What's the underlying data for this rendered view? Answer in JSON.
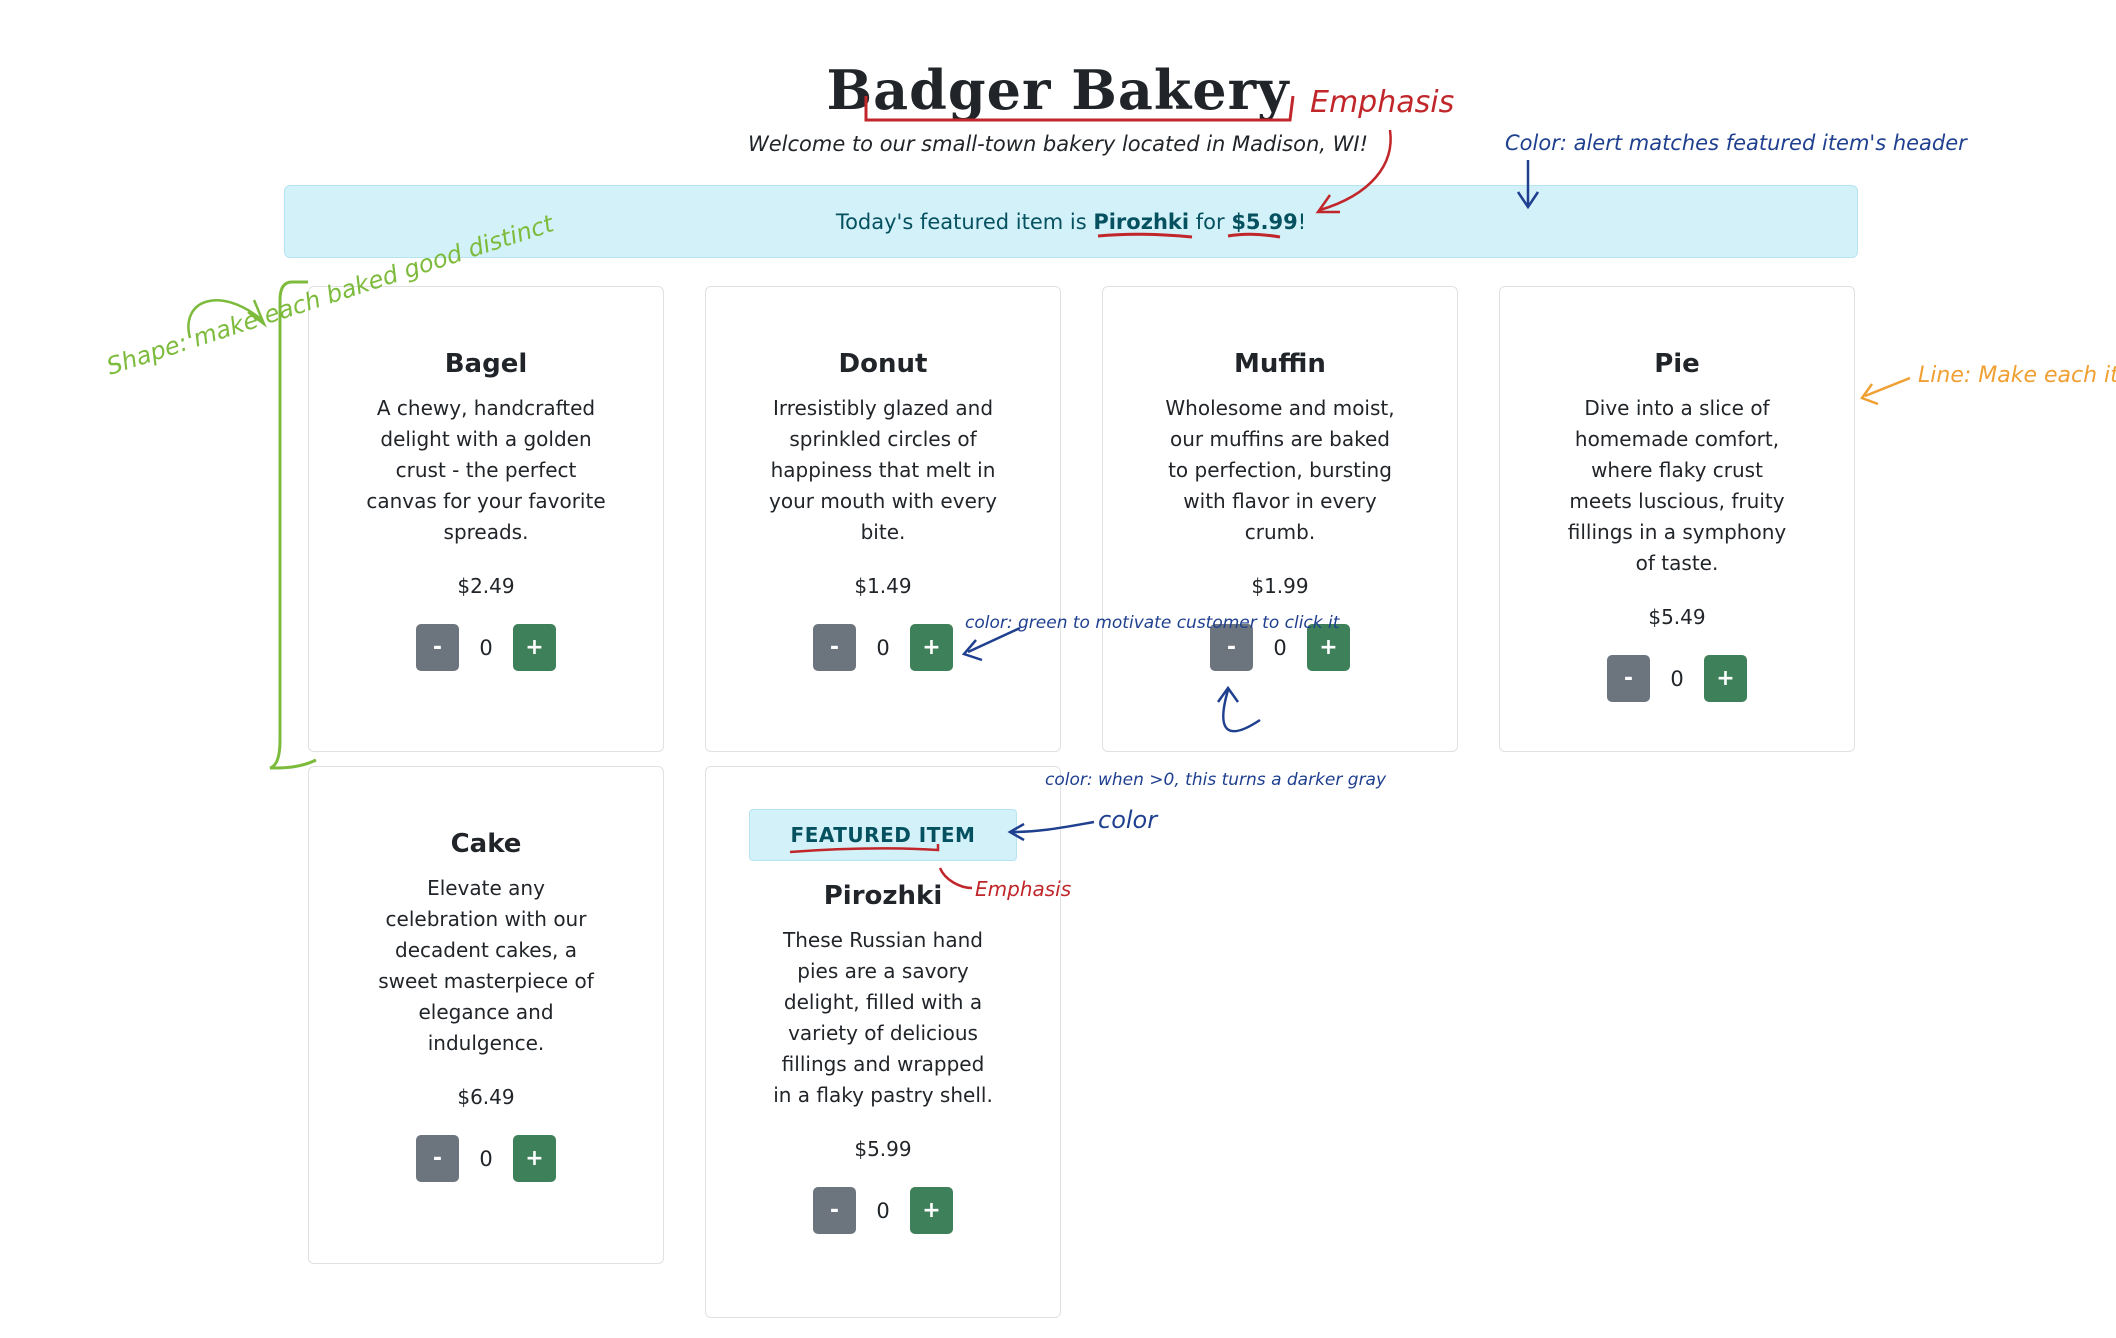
{
  "header": {
    "title": "Badger Bakery",
    "subtitle": "Welcome to our small-town bakery located in Madison, WI!"
  },
  "alert": {
    "prefix": "Today's featured item is ",
    "item": "Pirozhki",
    "middle": " for ",
    "price": "$5.99",
    "suffix": "!"
  },
  "products": [
    {
      "name": "Bagel",
      "description": "A chewy, handcrafted delight with a golden crust - the perfect canvas for your favorite spreads.",
      "price": "$2.49",
      "quantity": "0"
    },
    {
      "name": "Donut",
      "description": "Irresistibly glazed and sprinkled circles of happiness that melt in your mouth with every bite.",
      "price": "$1.49",
      "quantity": "0"
    },
    {
      "name": "Muffin",
      "description": "Wholesome and moist, our muffins are baked to perfection, bursting with flavor in every crumb.",
      "price": "$1.99",
      "quantity": "0"
    },
    {
      "name": "Pie",
      "description": "Dive into a slice of homemade comfort, where flaky crust meets luscious, fruity fillings in a symphony of taste.",
      "price": "$5.49",
      "quantity": "0"
    },
    {
      "name": "Cake",
      "description": "Elevate any celebration with our decadent cakes, a sweet masterpiece of elegance and indulgence.",
      "price": "$6.49",
      "quantity": "0"
    },
    {
      "name": "Pirozhki",
      "description": "These Russian hand pies are a savory delight, filled with a variety of delicious fillings and wrapped in a flaky pastry shell.",
      "price": "$5.99",
      "quantity": "0",
      "badge": "FEATURED ITEM"
    }
  ],
  "buttons": {
    "minus": "-",
    "plus": "+"
  },
  "annotations": {
    "emphasis_title": "Emphasis",
    "alert_color": "Color: alert matches featured item's header",
    "shape": "Shape: make each baked good distinct",
    "line": "Line: Make each item more distinct",
    "plus_color": "color: green to motivate customer to click it",
    "minus_color": "color: when >0, this turns a darker gray",
    "badge_color": "color",
    "badge_emphasis": "Emphasis"
  },
  "colors": {
    "alert_bg": "#d3f1f9",
    "alert_text": "#055160",
    "minus_button": "#6c757d",
    "plus_button": "#3d8059",
    "annotation_red": "#c0262a",
    "annotation_blue": "#1f3f8f",
    "annotation_green": "#7dbb3c",
    "annotation_orange": "#f0a033"
  }
}
